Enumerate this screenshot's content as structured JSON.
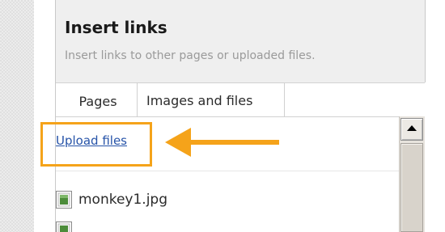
{
  "panel": {
    "title": "Insert links",
    "subtitle": "Insert links to other pages or uploaded files."
  },
  "tabs": [
    {
      "label": "Pages",
      "active": false
    },
    {
      "label": "Images and files",
      "active": true
    }
  ],
  "upload": {
    "link_label": "Upload files"
  },
  "files": [
    {
      "name": "monkey1.jpg",
      "icon": "image-file-icon"
    },
    {
      "name": "",
      "icon": "image-file-icon"
    }
  ],
  "colors": {
    "highlight": "#f5a31a",
    "link": "#2653a8"
  }
}
